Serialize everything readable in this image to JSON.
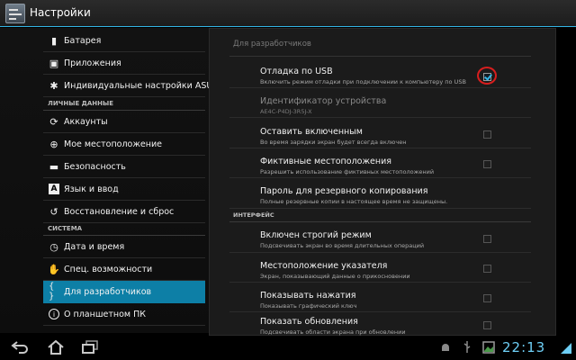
{
  "app": {
    "title": "Настройки",
    "icon": "settings-sliders-icon"
  },
  "left_menu": {
    "items": [
      {
        "label": "Батарея",
        "icon": "battery-icon"
      },
      {
        "label": "Приложения",
        "icon": "apps-icon"
      },
      {
        "label": "Индивидуальные настройки ASUS",
        "icon": "gear-icon"
      },
      {
        "label": "Аккаунты",
        "icon": "sync-icon"
      },
      {
        "label": "Мое местоположение",
        "icon": "location-icon"
      },
      {
        "label": "Безопасность",
        "icon": "lock-icon"
      },
      {
        "label": "Язык и ввод",
        "icon": "language-icon"
      },
      {
        "label": "Восстановление и сброс",
        "icon": "restore-icon"
      },
      {
        "label": "Дата и время",
        "icon": "clock-icon"
      },
      {
        "label": "Спец. возможности",
        "icon": "hand-icon"
      },
      {
        "label": "Для разработчиков",
        "icon": "braces-icon",
        "active": true
      },
      {
        "label": "О планшетном ПК",
        "icon": "info-icon"
      }
    ],
    "headers": {
      "personal": "ЛИЧНЫЕ ДАННЫЕ",
      "system": "СИСТЕМА"
    }
  },
  "developer": {
    "title": "Для разработчиков",
    "section_interface": "ИНТЕРФЕЙС",
    "items": [
      {
        "title": "Отладка по USB",
        "summary": "Включить режим отладки при подключении к компьютеру по USB",
        "checked": true
      },
      {
        "title": "Идентификатор устройства",
        "summary": "AE4C-P4DJ-3R5J-X",
        "disabled": true
      },
      {
        "title": "Оставить включенным",
        "summary": "Во время зарядки экран будет всегда включен",
        "checked": false
      },
      {
        "title": "Фиктивные местоположения",
        "summary": "Разрешить использование фиктивных местоположений",
        "checked": false
      },
      {
        "title": "Пароль для резервного копирования",
        "summary": "Полные резервные копии в настоящее время не защищены."
      },
      {
        "title": "Включен строгий режим",
        "summary": "Подсвечивать экран во время длительных операций",
        "checked": false
      },
      {
        "title": "Местоположение указателя",
        "summary": "Экран, показывающий данные о прикосновении",
        "checked": false
      },
      {
        "title": "Показывать нажатия",
        "summary": "Показывать графический ключ",
        "checked": false
      },
      {
        "title": "Показать обновления",
        "summary": "Подсвечивать области экрана при обновлении",
        "checked": false
      }
    ]
  },
  "navbar": {
    "buttons": [
      "back-icon",
      "home-icon",
      "recent-apps-icon"
    ],
    "status_icons": [
      "android-debug-icon",
      "usb-icon",
      "gallery-icon"
    ],
    "clock": "22:13",
    "signal_icon": "signal-icon"
  },
  "colors": {
    "accent": "#33b5e5",
    "selected_item": "#0d7fa6",
    "highlight_circle": "#d81e1e"
  }
}
